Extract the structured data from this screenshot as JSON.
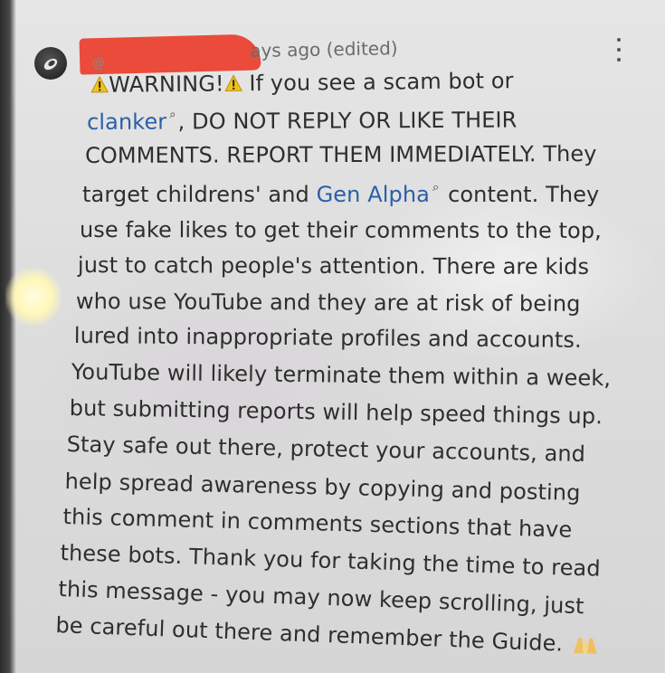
{
  "comment": {
    "meta": "ays ago (edited)",
    "handle_prefix": "@",
    "lines": [
      [
        "",
        "WARNING!",
        "",
        " If you see a scam bot or"
      ],
      [
        "clanker",
        ", DO NOT REPLY OR LIKE THEIR"
      ],
      [
        "COMMENTS. REPORT THEM IMMEDIATELY. They"
      ],
      [
        "target childrens' and ",
        "Gen Alpha",
        " content. They"
      ],
      [
        "use fake likes to get their comments to the top,"
      ],
      [
        "just to catch people's attention. There are kids"
      ],
      [
        "who use YouTube and they are at risk of being"
      ],
      [
        "lured into inappropriate profiles and accounts."
      ],
      [
        "YouTube will likely terminate them within a week,"
      ],
      [
        "but submitting reports will help speed things up."
      ],
      [
        "Stay safe out there, protect your accounts, and"
      ],
      [
        "help spread awareness by copying and posting"
      ],
      [
        "this comment in comments sections that have"
      ],
      [
        "these bots. Thank you for taking the time to read"
      ],
      [
        "this message - you may now keep scrolling, just"
      ],
      [
        "be careful out there and remember the Guide."
      ]
    ],
    "icons": {
      "warning": "warning-icon",
      "search": "search-icon",
      "hands": "folded-hands-icon",
      "menu": "more-vert-icon"
    },
    "colors": {
      "link": "#2b5fa8",
      "text": "#2e2e2e",
      "redaction": "#ea4b3b"
    }
  }
}
